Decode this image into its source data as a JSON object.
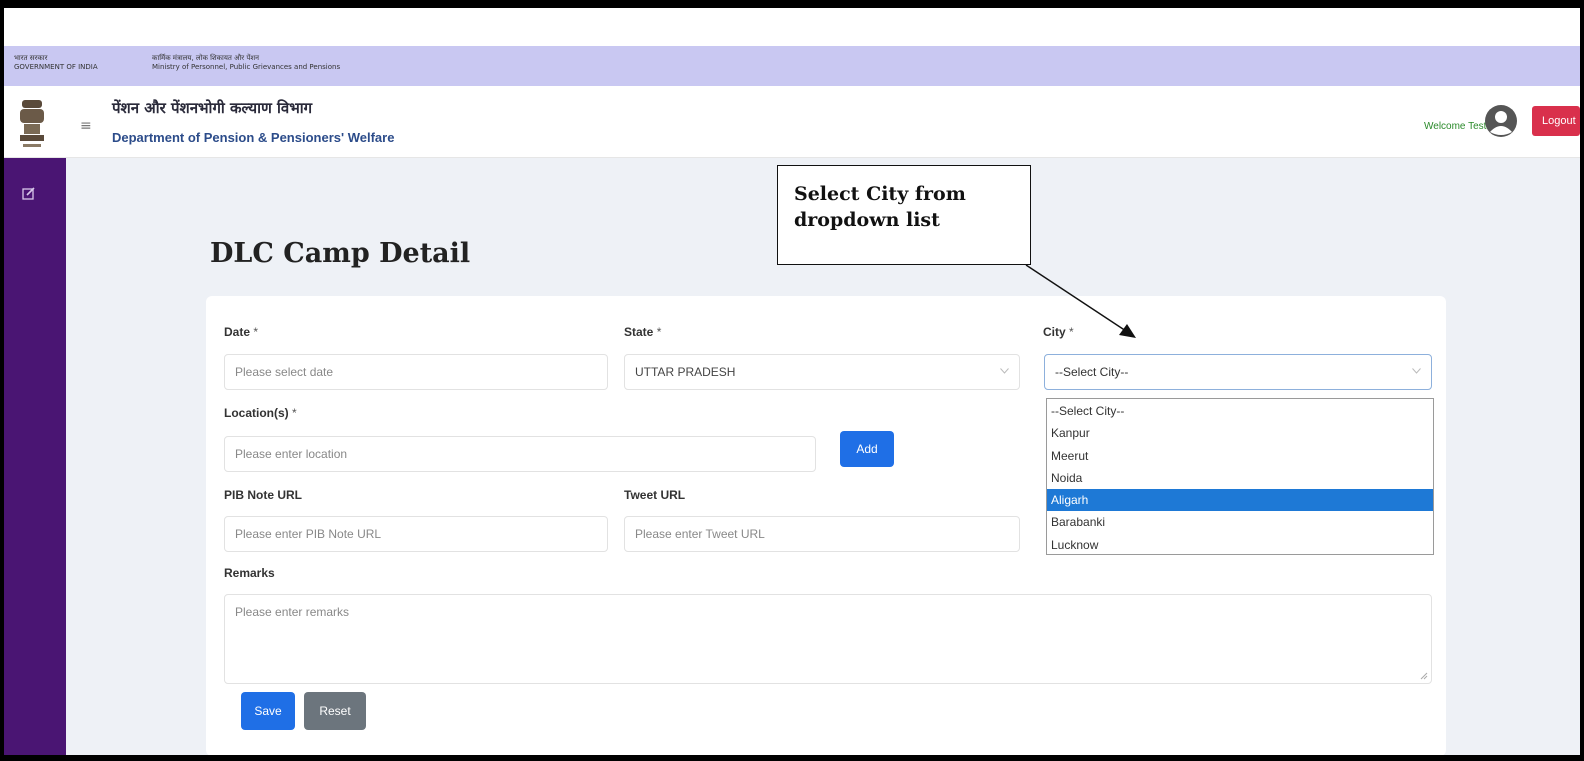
{
  "gov_banner": {
    "line1_left": "भारत सरकार",
    "line2_left": "GOVERNMENT OF INDIA",
    "line1_right": "कार्मिक मंत्रालय, लोक शिकायत और पेंशन",
    "line2_right": "Ministry of Personnel, Public Grievances and Pensions"
  },
  "header": {
    "dept_hindi": "पेंशन और पेंशनभोगी कल्याण विभाग",
    "dept_english": "Department of Pension & Pensioners' Welfare",
    "welcome": "Welcome Test User",
    "logout_label": "Logout"
  },
  "page": {
    "title": "DLC Camp Detail"
  },
  "form": {
    "date": {
      "label": "Date",
      "required": "*",
      "placeholder": "Please select date"
    },
    "state": {
      "label": "State",
      "required": "*",
      "value": "UTTAR PRADESH"
    },
    "city": {
      "label": "City",
      "required": "*",
      "value": "--Select City--"
    },
    "location": {
      "label": "Location(s)",
      "required": "*",
      "placeholder": "Please enter location",
      "add_label": "Add"
    },
    "pib": {
      "label": "PIB Note URL",
      "placeholder": "Please enter PIB Note URL"
    },
    "tweet": {
      "label": "Tweet URL",
      "placeholder": "Please enter Tweet URL"
    },
    "remarks": {
      "label": "Remarks",
      "placeholder": "Please enter remarks"
    },
    "save_label": "Save",
    "reset_label": "Reset"
  },
  "city_dropdown": {
    "options": [
      "--Select City--",
      "Kanpur",
      "Meerut",
      "Noida",
      "Aligarh",
      "Barabanki",
      "Lucknow"
    ],
    "highlighted_index": 4
  },
  "annotation": {
    "line1": "Select City from",
    "line2": "dropdown list"
  },
  "colors": {
    "sidebar": "#4a1573",
    "gov_banner": "#c9c8f2",
    "primary": "#1f6fe6",
    "logout": "#d9304c",
    "highlight": "#1e79d6"
  }
}
